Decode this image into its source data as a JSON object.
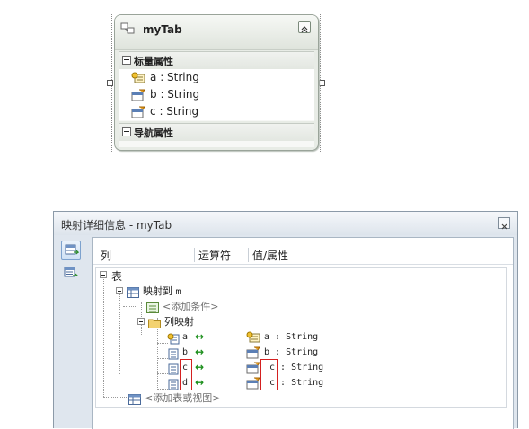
{
  "entity": {
    "title": "myTab",
    "scalar_section": "标量属性",
    "properties": [
      {
        "name": "a",
        "type": ": String",
        "key": true
      },
      {
        "name": "b",
        "type": ": String",
        "key": false
      },
      {
        "name": "c",
        "type": ": String",
        "key": false
      }
    ],
    "nav_section": "导航属性"
  },
  "mapping": {
    "window_title": "映射详细信息 - myTab",
    "columns": {
      "col": "列",
      "operator": "运算符",
      "value": "值/属性"
    },
    "tree": {
      "table_node": "表",
      "maps_to": "映射到",
      "maps_to_target": "m",
      "add_condition": "<添加条件>",
      "column_mappings": "列映射",
      "rows": [
        {
          "col": "a",
          "value": "a : String"
        },
        {
          "col": "b",
          "value": "b : String"
        },
        {
          "col": "c",
          "value": "c : String"
        },
        {
          "col": "d",
          "value": "c : String"
        }
      ],
      "add_table": "<添加表或视图>"
    }
  },
  "colors": {
    "highlight": "#d42020",
    "arrow": "#1c8f1c"
  }
}
